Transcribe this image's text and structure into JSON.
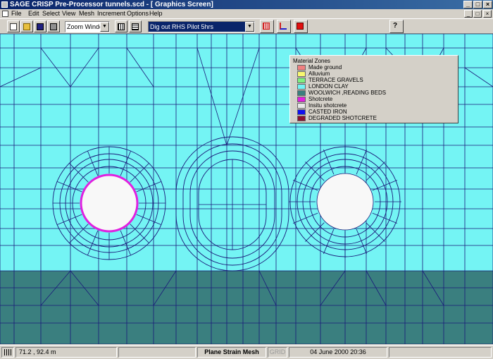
{
  "window": {
    "title": "SAGE CRISP Pre-Processor tunnels.scd - [ Graphics Screen]",
    "controls": {
      "minimize": "_",
      "maximize": "□",
      "close": "×"
    }
  },
  "menu": {
    "items": [
      "File",
      "Edit",
      "Select",
      "View",
      "Mesh",
      "Increment",
      "Options",
      "Help"
    ],
    "mdi_controls": {
      "minimize": "_",
      "restore": "□",
      "close": "×"
    }
  },
  "toolbar": {
    "zoom_select": "Zoom Window",
    "increment_select": "Dig out RHS Pilot 5hrs",
    "icons": [
      "new-file-icon",
      "open-folder-icon",
      "save-icon",
      "print-icon",
      "grid-view-icon",
      "list-view-icon",
      "mesh-red-icon",
      "axes-icon",
      "red-square-icon",
      "help-pointer-icon"
    ]
  },
  "legend": {
    "title": "Material Zones",
    "zones": [
      {
        "label": "Made ground",
        "color": "#f08080"
      },
      {
        "label": "Alluvium",
        "color": "#f8f870"
      },
      {
        "label": "TERRACE GRAVELS",
        "color": "#80f080"
      },
      {
        "label": "LONDON CLAY",
        "color": "#74f4f4"
      },
      {
        "label": "WOOLWICH ,READING BEDS",
        "color": "#3a7f7f"
      },
      {
        "label": "Shotcrete",
        "color": "#e020e0"
      },
      {
        "label": "Insitu shotcrete",
        "color": "#e8e8e8"
      },
      {
        "label": "CASTED IRON",
        "color": "#1010f0"
      },
      {
        "label": "DEGRADED SHOTCRETE",
        "color": "#8b1030"
      }
    ]
  },
  "canvas": {
    "upper_color": "#74f4f4",
    "lower_color": "#3a7f7f",
    "mesh_color": "#1a1a7a",
    "opening_color": "#f8f8f8",
    "lining_color": "#e020e0"
  },
  "status": {
    "coords": "71.2 , 92.4 m",
    "mode": "Plane Strain Mesh",
    "grid": "GRID",
    "datetime": "04 June 2000 20:36"
  }
}
